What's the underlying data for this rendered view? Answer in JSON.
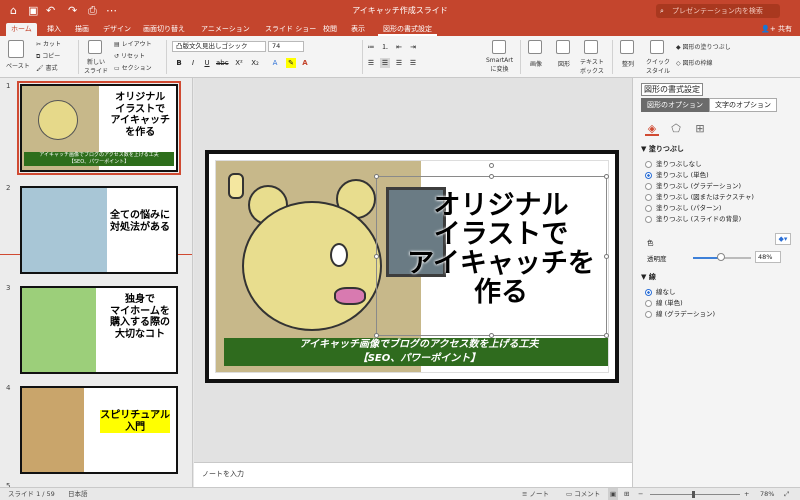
{
  "window": {
    "title": "アイキャッチ作成スライド",
    "search_placeholder": "プレゼンテーション内を検索"
  },
  "quick_access": [
    "home-icon",
    "save-icon",
    "undo-icon",
    "redo-icon",
    "print-icon",
    "more-icon"
  ],
  "tabs": [
    "ホーム",
    "挿入",
    "描画",
    "デザイン",
    "画面切り替え",
    "アニメーション",
    "スライド ショー",
    "校閲",
    "表示",
    "図形の書式設定"
  ],
  "share_label": "共有",
  "ribbon": {
    "paste": "ペースト",
    "cut": "カット",
    "copy": "コピー",
    "format": "書式",
    "new_slide": "新しい\nスライド",
    "layout": "レイアウト",
    "reset": "リセット",
    "section": "セクション",
    "font_name": "凸版文久見出しゴシック",
    "font_size": "74",
    "smartart": "SmartArt\nに変換",
    "picture": "画像",
    "shapes": "図形",
    "textbox": "テキスト\nボックス",
    "arrange": "整列",
    "quick_styles": "クイック\nスタイル",
    "shape_fill": "図形の塗りつぶし",
    "shape_outline": "図形の枠線"
  },
  "slides": [
    {
      "num": "1",
      "title": "オリジナル\nイラストで\nアイキャッチ\nを作る",
      "band": "アイキャッチ画像でブログのアクセス数を上げる工夫\n【SEO、パワーポイント】"
    },
    {
      "num": "2",
      "title": "全ての悩みに\n対処法がある"
    },
    {
      "num": "3",
      "title": "独身で\nマイホームを\n購入する際の\n大切なコト"
    },
    {
      "num": "4",
      "title": "スピリチュアル\n入門"
    },
    {
      "num": "5"
    }
  ],
  "main_slide": {
    "title": "オリジナル\nイラストで\nアイキャッチを\n作る",
    "band": "アイキャッチ画像でブログのアクセス数を上げる工夫\n【SEO、パワーポイント】"
  },
  "notes_placeholder": "ノートを入力",
  "pane": {
    "title": "図形の書式設定",
    "tab_shape": "図形のオプション",
    "tab_text": "文字のオプション",
    "fill_header": "塗りつぶし",
    "fill_options": [
      "塗りつぶしなし",
      "塗りつぶし (単色)",
      "塗りつぶし (グラデーション)",
      "塗りつぶし (図またはテクスチャ)",
      "塗りつぶし (パターン)",
      "塗りつぶし (スライドの背景)"
    ],
    "color_label": "色",
    "transparency_label": "透明度",
    "transparency_value": "48%",
    "transparency_level": 0.48,
    "line_header": "線",
    "line_options": [
      "線なし",
      "線 (単色)",
      "線 (グラデーション)"
    ]
  },
  "status": {
    "slide": "スライド 1 / 59",
    "lang": "日本語",
    "notes": "ノート",
    "comments": "コメント",
    "zoom": "78%"
  },
  "colors": {
    "accent": "#c4452d",
    "band_green": "#2f6b1e"
  }
}
